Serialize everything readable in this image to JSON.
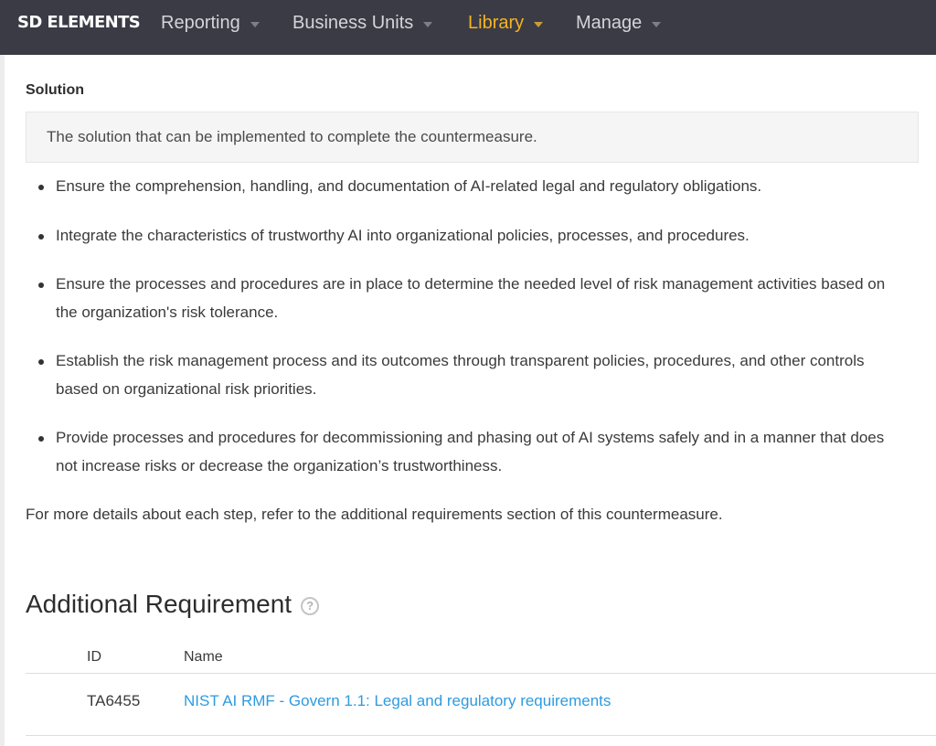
{
  "app": {
    "logo_text": "SD ELEMENTS"
  },
  "nav": {
    "items": [
      {
        "label": "Reporting"
      },
      {
        "label": "Business Units"
      },
      {
        "label": "Library",
        "active": true
      },
      {
        "label": "Manage"
      }
    ]
  },
  "colors": {
    "nav_background": "#3a3b45",
    "nav_active": "#f5b324",
    "link": "#2d9be0"
  },
  "solution": {
    "heading": "Solution",
    "description": "The solution that can be implemented to complete the countermeasure.",
    "steps": [
      "Ensure the comprehension, handling, and documentation of AI-related legal and regulatory obligations.",
      "Integrate the characteristics of trustworthy AI into organizational policies, processes, and procedures.",
      "Ensure the processes and procedures are in place to determine the needed level of risk management activities based on the organization's risk tolerance.",
      "Establish the risk management process and its outcomes through transparent policies, procedures, and other controls based on organizational risk priorities.",
      "Provide processes and procedures for decommissioning and phasing out of AI systems safely and in a manner that does not increase risks or decrease the organization’s trustworthiness."
    ],
    "note": "For more details about each step, refer to the additional requirements section of this countermeasure."
  },
  "additional_requirement": {
    "title": "Additional Requirement",
    "help_icon": "question-circle-icon",
    "columns": {
      "id": "ID",
      "name": "Name"
    },
    "rows": [
      {
        "id": "TA6455",
        "name": "NIST AI RMF - Govern 1.1: Legal and regulatory requirements"
      }
    ]
  }
}
